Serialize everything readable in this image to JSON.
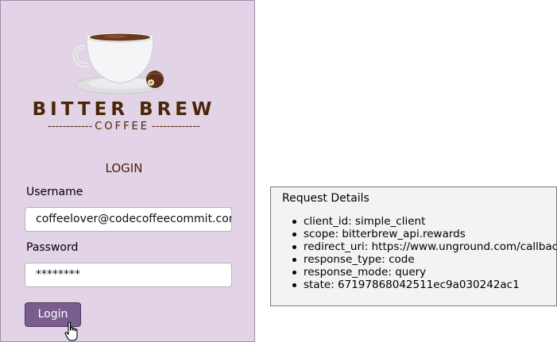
{
  "brand": {
    "name": "BITTER BREW",
    "sub_word": "COFFEE",
    "sub_left_dashes": "------------",
    "sub_right_dashes": "-------------",
    "logo_icon": "coffee-cup-icon"
  },
  "login": {
    "heading": "LOGIN",
    "username_label": "Username",
    "username_value": "coffeelover@codecoffeecommit.com",
    "password_label": "Password",
    "password_value": "********",
    "button_label": "Login"
  },
  "request_details": {
    "title": "Request Details",
    "items": [
      "client_id: simple_client",
      "scope: bitterbrew_api.rewards",
      "redirect_uri: https://www.unground.com/callback",
      "response_type: code",
      "response_mode: query",
      "state: 67197868042511ec9a030242ac1"
    ]
  },
  "colors": {
    "panel_bg": "#e2d3e6",
    "brand_brown": "#4a2508",
    "button_bg": "#7a5d8f",
    "details_bg": "#f3f3f3"
  }
}
